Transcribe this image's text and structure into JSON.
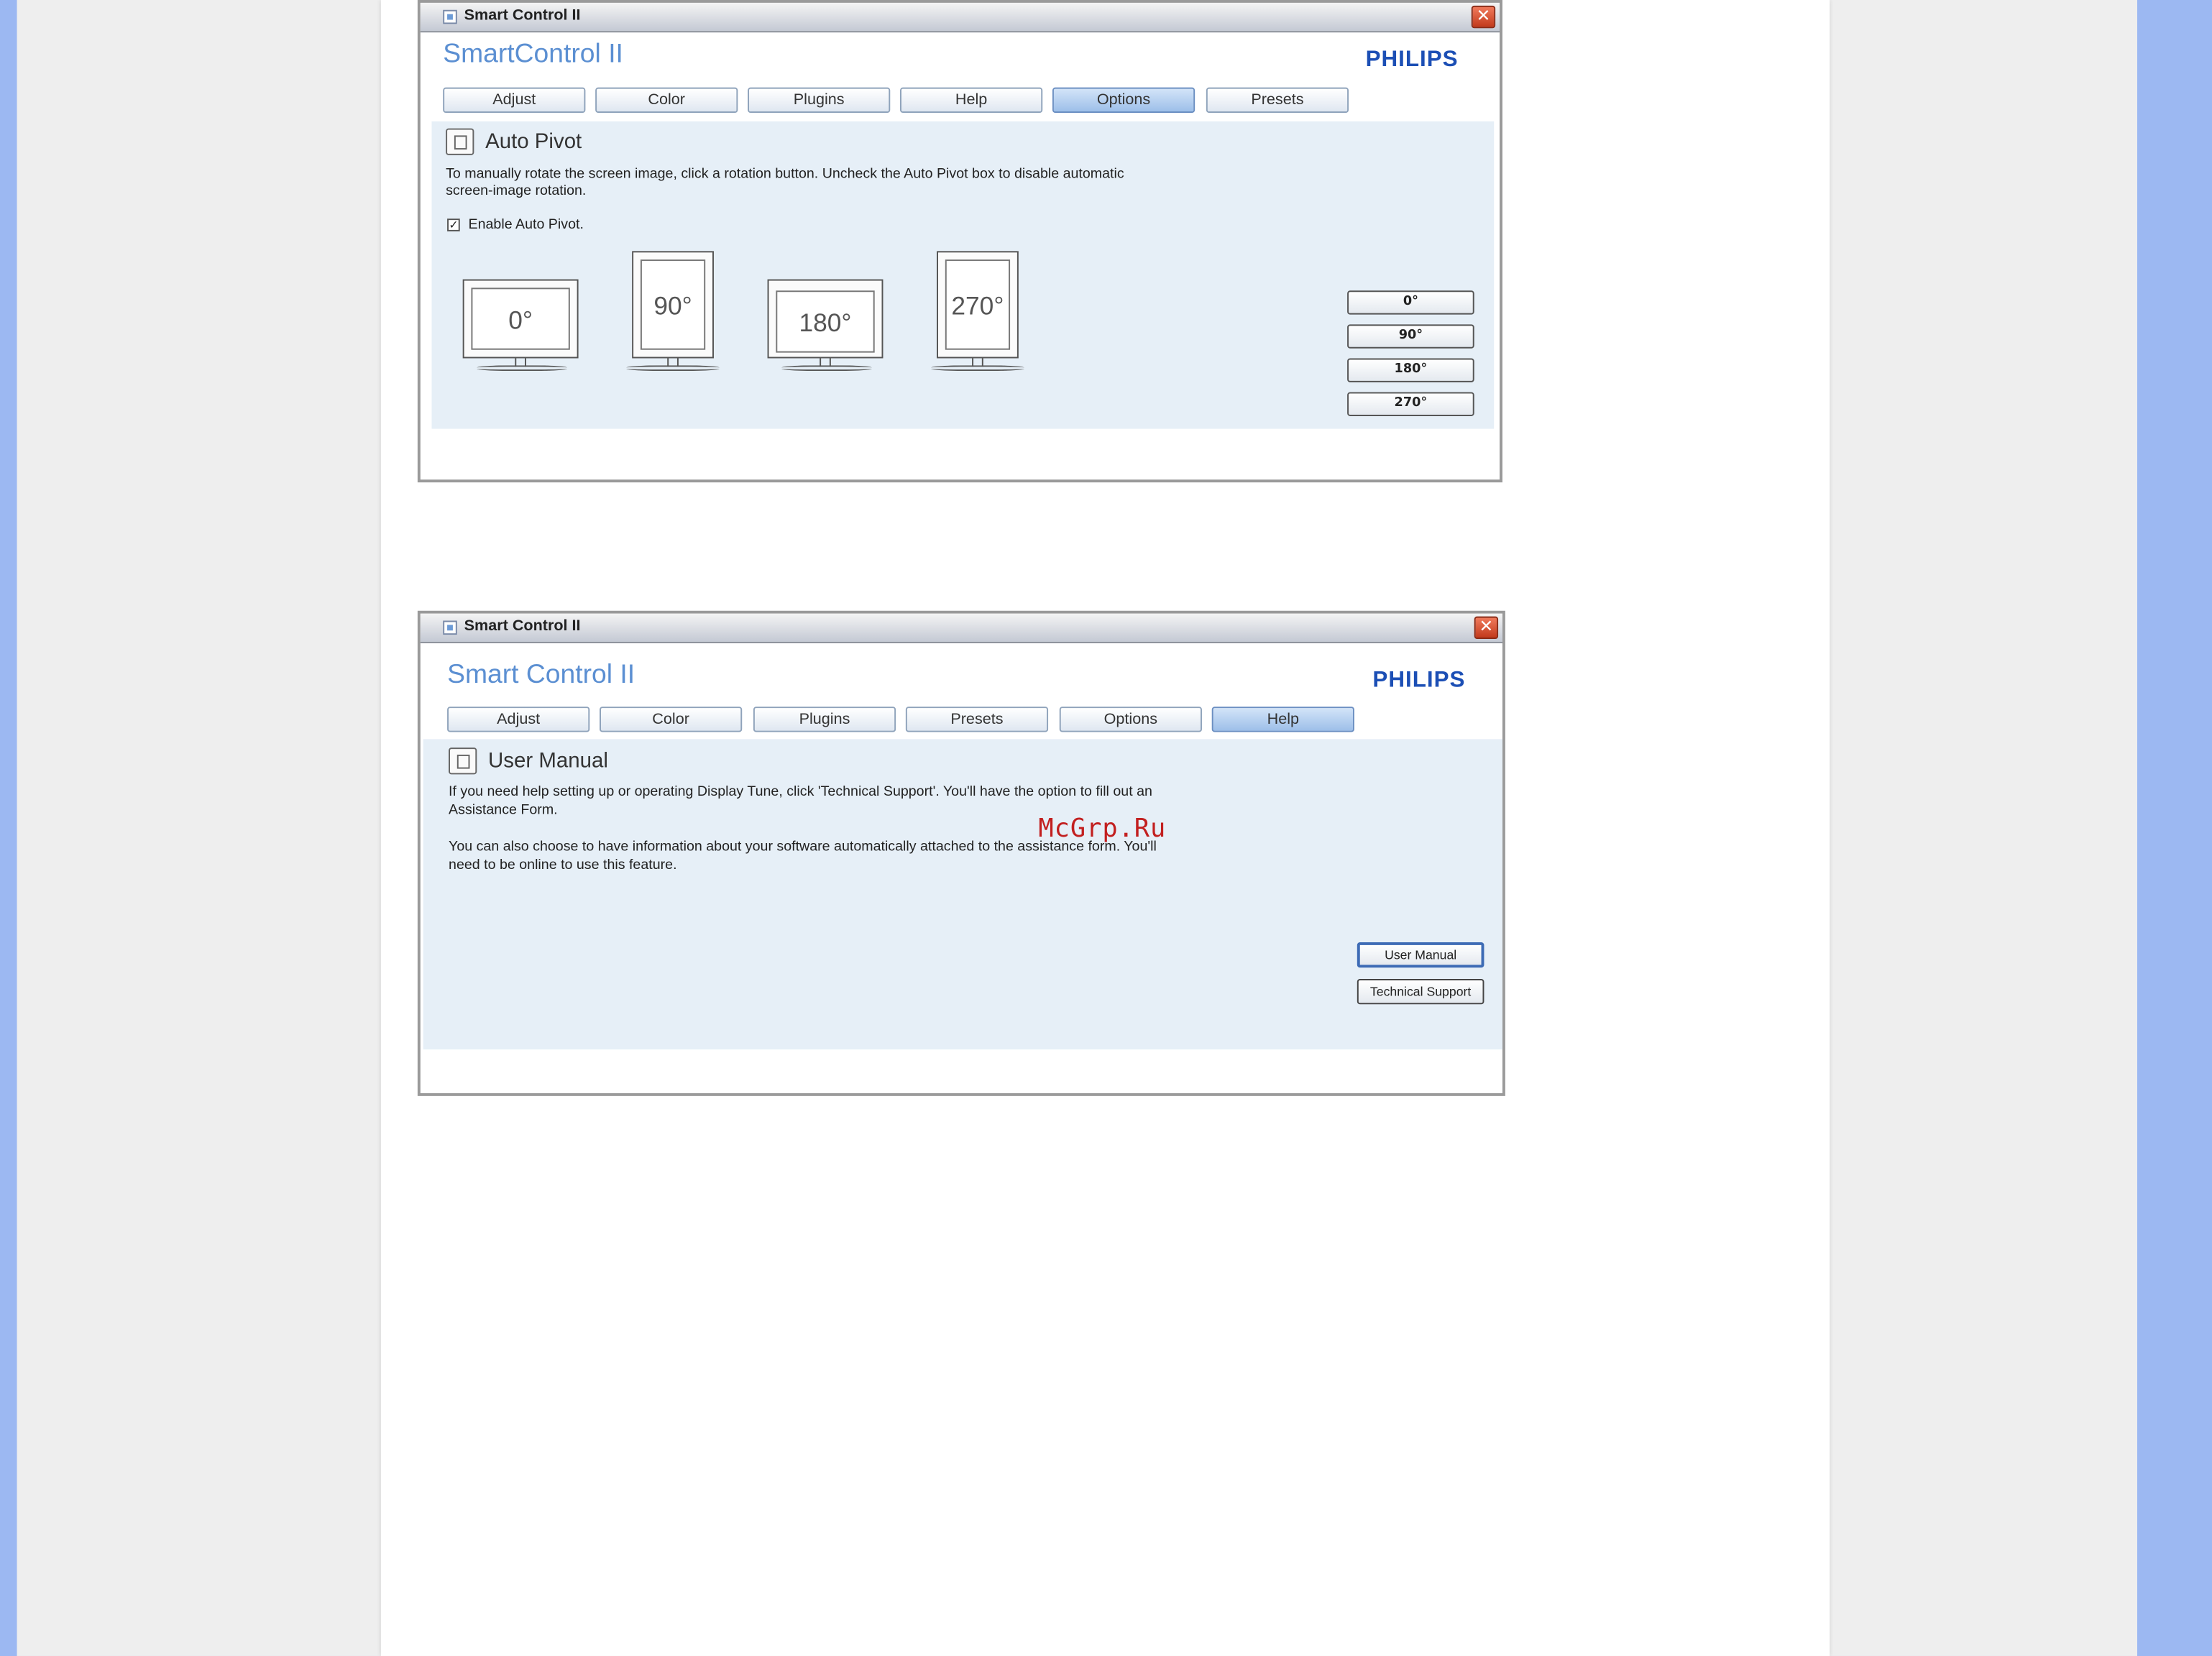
{
  "window1": {
    "title": "Smart Control II",
    "app_title": "SmartControl II",
    "brand": "PHILIPS",
    "tabs": [
      {
        "label": "Adjust"
      },
      {
        "label": "Color"
      },
      {
        "label": "Plugins"
      },
      {
        "label": "Help"
      },
      {
        "label": "Options",
        "active": true
      },
      {
        "label": "Presets"
      }
    ],
    "section_title": "Auto Pivot",
    "description_line1": "To manually rotate the screen image, click a rotation button. Uncheck the Auto Pivot box to disable automatic",
    "description_line2": "screen-image rotation.",
    "checkbox_checked_mark": "✓",
    "checkbox_label": "Enable Auto Pivot.",
    "monitors": [
      {
        "label": "0°"
      },
      {
        "label": "90°"
      },
      {
        "label": "180°"
      },
      {
        "label": "270°"
      }
    ],
    "rotation_buttons": [
      {
        "label": "0°"
      },
      {
        "label": "90°"
      },
      {
        "label": "180°"
      },
      {
        "label": "270°"
      }
    ]
  },
  "window2": {
    "title": "Smart Control II",
    "app_title": "Smart Control II",
    "brand": "PHILIPS",
    "tabs": [
      {
        "label": "Adjust"
      },
      {
        "label": "Color"
      },
      {
        "label": "Plugins"
      },
      {
        "label": "Presets"
      },
      {
        "label": "Options"
      },
      {
        "label": "Help",
        "active": true
      }
    ],
    "section_title": "User Manual",
    "paragraph1_line1": "If you need help setting up or operating Display Tune, click 'Technical Support'. You'll have the option to fill out an",
    "paragraph1_line2": "Assistance Form.",
    "paragraph2_line1": "You can also choose to have information about your software automatically attached to the assistance form. You'll",
    "paragraph2_line2": "need to be online to use this feature.",
    "buttons": {
      "user_manual": "User Manual",
      "technical_support": "Technical Support"
    }
  },
  "watermark": "McGrp.Ru",
  "colors": {
    "outer_background": "#9cb8f2",
    "app_title": "#5b8fd2",
    "brand": "#1c4fb5",
    "content_panel": "#e6eff7",
    "watermark": "#c21f1f"
  },
  "icons": {
    "title_icon": "app-icon",
    "close_icon": "close-x",
    "auto_pivot_icon": "pivot-icon",
    "user_manual_icon": "manual-icon"
  },
  "close_glyph": "✕"
}
